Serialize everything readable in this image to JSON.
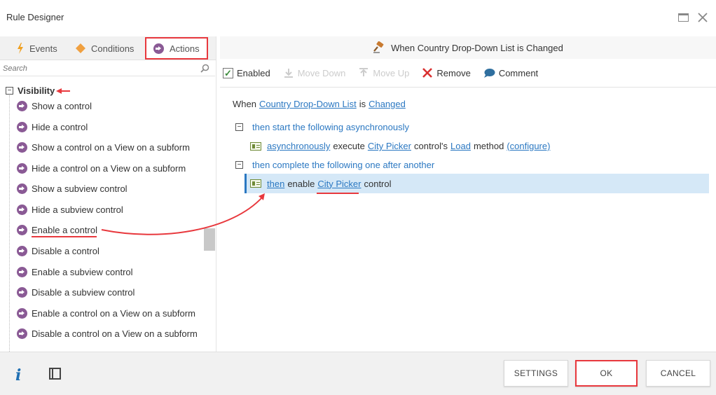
{
  "window": {
    "title": "Rule Designer"
  },
  "tabs": [
    {
      "label": "Events",
      "icon": "lightning-icon"
    },
    {
      "label": "Conditions",
      "icon": "diamond-icon"
    },
    {
      "label": "Actions",
      "icon": "arrow-circle-icon"
    }
  ],
  "search": {
    "placeholder": "Search"
  },
  "tree": {
    "group": "Visibility",
    "items": [
      "Show a control",
      "Hide a control",
      "Show a control on a View on a subform",
      "Hide a control on a View on a subform",
      "Show a subview control",
      "Hide a subview control",
      "Enable a control",
      "Disable a control",
      "Enable a subview control",
      "Disable a subview control",
      "Enable a control on a View on a subform",
      "Disable a control on a View on a subform"
    ]
  },
  "rule": {
    "title": "When Country Drop-Down List is Changed",
    "toolbar": {
      "enabled": "Enabled",
      "move_down": "Move Down",
      "move_up": "Move Up",
      "remove": "Remove",
      "comment": "Comment"
    },
    "when": {
      "prefix": "When",
      "control": "Country Drop-Down List",
      "mid": "is",
      "event": "Changed"
    },
    "block1": {
      "label": "then start the following asynchronously"
    },
    "action1": {
      "async": "asynchronously",
      "execute": "execute",
      "control": "City Picker",
      "controls": "control's",
      "method": "Load",
      "method_word": "method",
      "configure": "(configure)"
    },
    "block2": {
      "label": "then complete the following one after another"
    },
    "action2": {
      "then": "then",
      "enable": "enable",
      "control": "City Picker",
      "suffix": "control"
    }
  },
  "footer": {
    "settings": "SETTINGS",
    "ok": "OK",
    "cancel": "CANCEL"
  },
  "colors": {
    "accent_red": "#e8383d",
    "link_blue": "#2b78c2",
    "action_purple": "#8a5a95",
    "selected_row": "#d5e8f7"
  }
}
